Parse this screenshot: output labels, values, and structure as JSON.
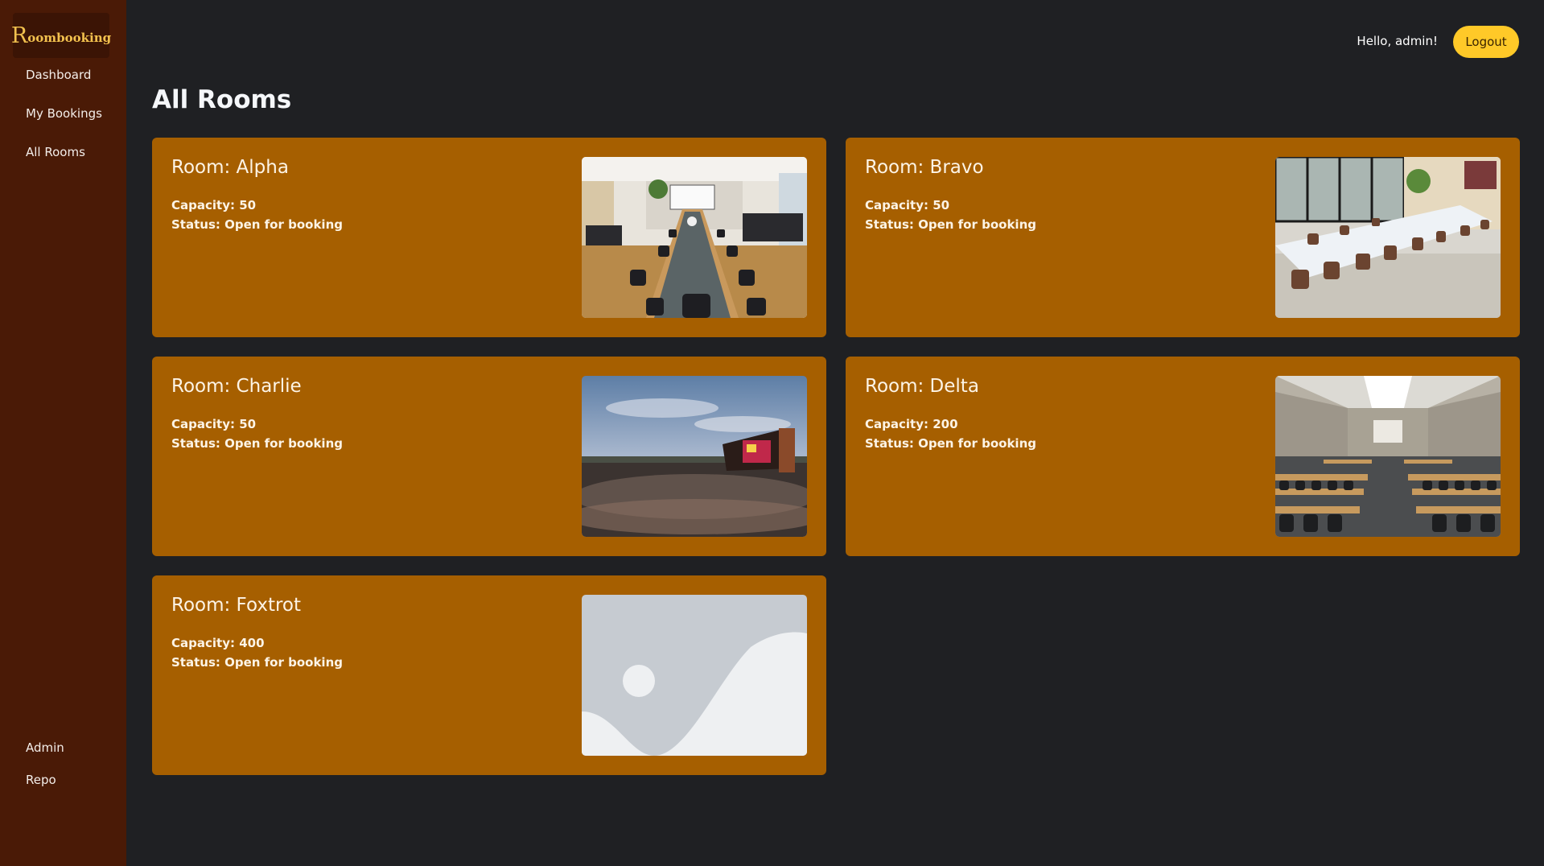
{
  "app": {
    "brand_initial": "R",
    "brand_rest": "oombooking"
  },
  "sidebar": {
    "items": [
      {
        "label": "Dashboard"
      },
      {
        "label": "My Bookings"
      },
      {
        "label": "All Rooms"
      }
    ],
    "bottom_items": [
      {
        "label": "Admin"
      },
      {
        "label": "Repo"
      }
    ]
  },
  "header": {
    "greeting": "Hello, admin!",
    "logout_label": "Logout"
  },
  "page": {
    "title": "All Rooms"
  },
  "rooms": [
    {
      "title": "Room: Alpha",
      "capacity": "Capacity: 50",
      "status": "Status: Open for booking",
      "image": "conference-room-photo"
    },
    {
      "title": "Room: Bravo",
      "capacity": "Capacity: 50",
      "status": "Status: Open for booking",
      "image": "meeting-room-photo"
    },
    {
      "title": "Room: Charlie",
      "capacity": "Capacity: 50",
      "status": "Status: Open for booking",
      "image": "stadium-concert-photo"
    },
    {
      "title": "Room: Delta",
      "capacity": "Capacity: 200",
      "status": "Status: Open for booking",
      "image": "classroom-hall-photo"
    },
    {
      "title": "Room: Foxtrot",
      "capacity": "Capacity: 400",
      "status": "Status: Open for booking",
      "image": "image-placeholder-icon"
    }
  ],
  "colors": {
    "sidebar": "#4a1a06",
    "brand_bg": "#3b1405",
    "brand_text": "#f2c14e",
    "background": "#1f2023",
    "card": "#a65f00",
    "logout": "#ffc928"
  }
}
